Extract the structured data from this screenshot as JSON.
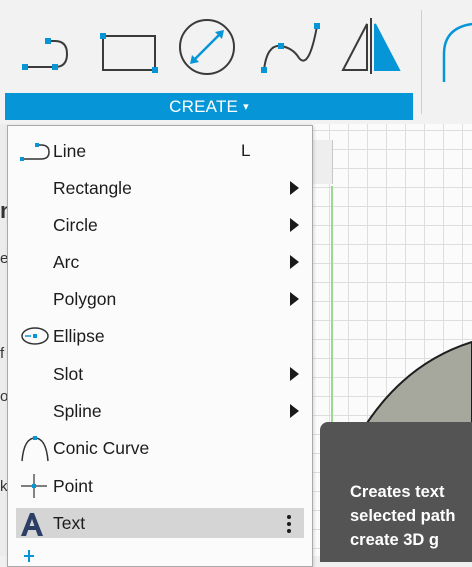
{
  "toolbar": {
    "tools": [
      {
        "icon": "line-tool-icon"
      },
      {
        "icon": "rectangle-tool-icon"
      },
      {
        "icon": "circle-tool-icon"
      },
      {
        "icon": "spline-tool-icon"
      },
      {
        "icon": "mirror-tool-icon"
      },
      {
        "icon": "arc-tool-icon"
      }
    ],
    "create_label": "CREATE",
    "create_caret": "▾",
    "accent_color": "#0696d7"
  },
  "side_fragments": [
    "n",
    "e",
    "f",
    "o",
    "k"
  ],
  "menu": {
    "items": [
      {
        "label": "Line",
        "icon": "line-icon",
        "shortcut": "L",
        "submenu": false
      },
      {
        "label": "Rectangle",
        "icon": null,
        "shortcut": "",
        "submenu": true
      },
      {
        "label": "Circle",
        "icon": null,
        "shortcut": "",
        "submenu": true
      },
      {
        "label": "Arc",
        "icon": null,
        "shortcut": "",
        "submenu": true
      },
      {
        "label": "Polygon",
        "icon": null,
        "shortcut": "",
        "submenu": true
      },
      {
        "label": "Ellipse",
        "icon": "ellipse-icon",
        "shortcut": "",
        "submenu": false
      },
      {
        "label": "Slot",
        "icon": null,
        "shortcut": "",
        "submenu": true
      },
      {
        "label": "Spline",
        "icon": null,
        "shortcut": "",
        "submenu": true
      },
      {
        "label": "Conic Curve",
        "icon": "conic-curve-icon",
        "shortcut": "",
        "submenu": false
      },
      {
        "label": "Point",
        "icon": "point-icon",
        "shortcut": "",
        "submenu": false
      },
      {
        "label": "Text",
        "icon": "text-icon",
        "shortcut": "",
        "submenu": false,
        "highlighted": true
      }
    ]
  },
  "tooltip": {
    "text": "Creates text\nselected path\ncreate 3D g"
  }
}
